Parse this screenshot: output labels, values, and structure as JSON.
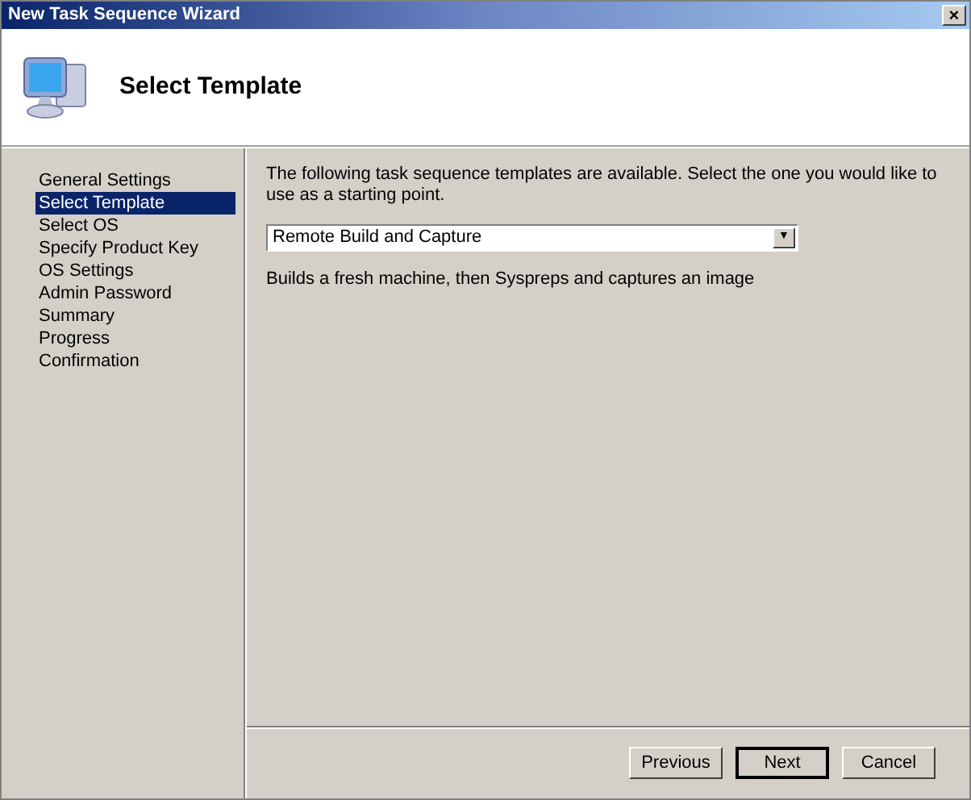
{
  "window": {
    "title": "New Task Sequence Wizard",
    "close": "×"
  },
  "header": {
    "title": "Select Template"
  },
  "steps": [
    {
      "label": "General Settings",
      "selected": false
    },
    {
      "label": "Select Template",
      "selected": true
    },
    {
      "label": "Select OS",
      "selected": false
    },
    {
      "label": "Specify Product Key",
      "selected": false
    },
    {
      "label": "OS Settings",
      "selected": false
    },
    {
      "label": "Admin Password",
      "selected": false
    },
    {
      "label": "Summary",
      "selected": false
    },
    {
      "label": "Progress",
      "selected": false
    },
    {
      "label": "Confirmation",
      "selected": false
    }
  ],
  "instructions": "The following task sequence templates are available.  Select the one you would like to use as a starting point.",
  "template": {
    "value": "Remote Build and Capture",
    "arrow": "▼"
  },
  "description": "Builds a fresh machine, then Syspreps and captures an image",
  "buttons": [
    {
      "label": "Previous",
      "default": false
    },
    {
      "label": "Next",
      "default": true
    },
    {
      "label": "Cancel",
      "default": false
    }
  ]
}
